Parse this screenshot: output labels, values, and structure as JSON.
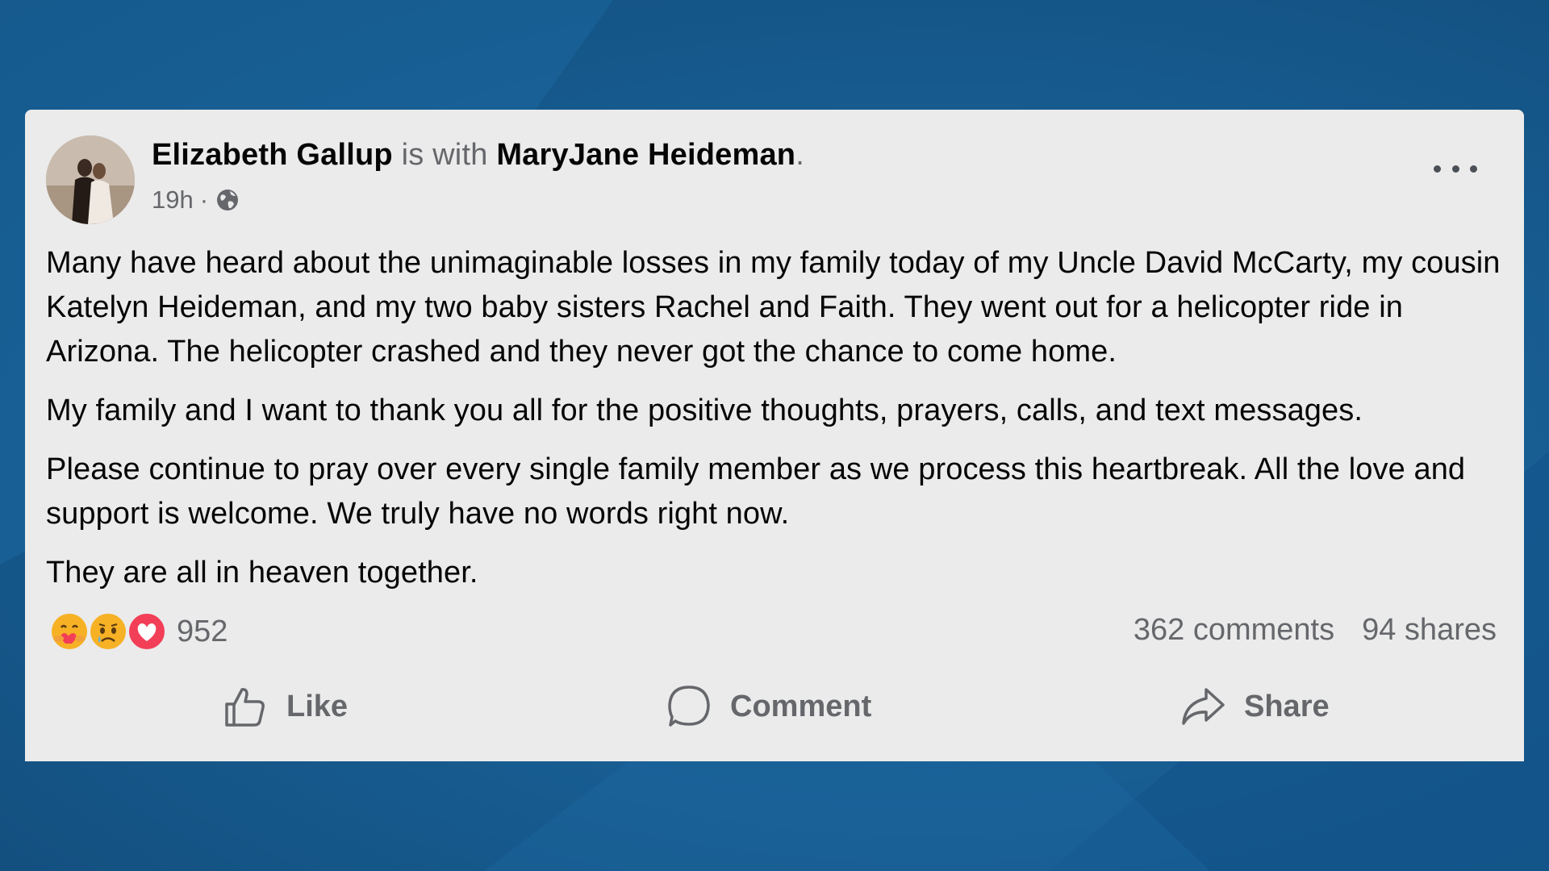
{
  "post": {
    "author": "Elizabeth Gallup",
    "with_text": "is with",
    "tagged": "MaryJane Heideman",
    "period": ".",
    "time": "19h",
    "separator": "·",
    "paragraphs": [
      "Many have heard about the unimaginable losses in my family today of my Uncle David McCarty, my cousin Katelyn Heideman, and my two baby sisters Rachel and Faith. They went out for a helicopter ride in Arizona. The helicopter crashed and they never got the chance to come home.",
      "My family and I want to thank you all for the positive thoughts, prayers, calls, and text messages.",
      "Please continue to pray over every single family member as we process this heartbreak. All the love and support is welcome. We truly have no words right now.",
      "They are all in heaven together."
    ],
    "reactions": {
      "icons": [
        "care-icon",
        "sad-icon",
        "love-icon"
      ],
      "count": "952"
    },
    "comments": "362 comments",
    "shares": "94 shares",
    "actions": {
      "like": "Like",
      "comment": "Comment",
      "share": "Share"
    }
  },
  "colors": {
    "background": "#185e93",
    "card": "#ebebeb",
    "text": "#050505",
    "secondary": "#65676b",
    "love": "#f33e58",
    "reaction_yellow": "#f7b125"
  }
}
